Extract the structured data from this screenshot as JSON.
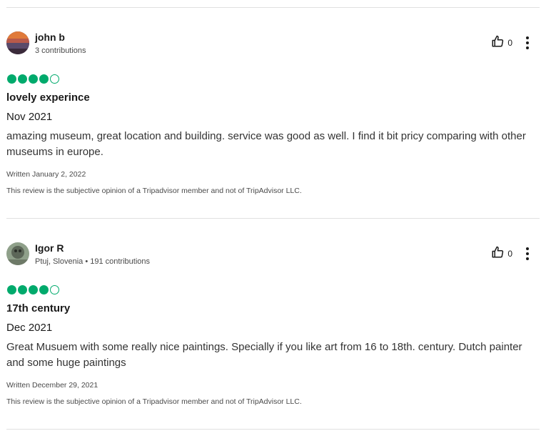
{
  "reviews": [
    {
      "user": "john b",
      "meta": "3 contributions",
      "helpful_votes": "0",
      "rating": 4,
      "title": "lovely experince",
      "visit_date": "Nov 2021",
      "body": "amazing museum, great location and building. service was good as well. I find it bit pricy comparing with other museums in europe.",
      "written": "Written January 2, 2022",
      "disclaimer": "This review is the subjective opinion of a Tripadvisor member and not of TripAdvisor LLC."
    },
    {
      "user": "Igor R",
      "meta": "Ptuj, Slovenia • 191 contributions",
      "helpful_votes": "0",
      "rating": 4,
      "title": "17th century",
      "visit_date": "Dec 2021",
      "body": "Great Musuem with some really nice paintings. Specially if you like art from 16 to 18th. century. Dutch painter and some huge paintings",
      "written": "Written December 29, 2021",
      "disclaimer": "This review is the subjective opinion of a Tripadvisor member and not of TripAdvisor LLC."
    }
  ],
  "colors": {
    "bubble": "#00aa6c",
    "divider": "#e0e0e0",
    "text": "#1a1a1a"
  },
  "icons": {
    "helpful": "thumbs-up-icon",
    "more": "more-options-icon"
  }
}
